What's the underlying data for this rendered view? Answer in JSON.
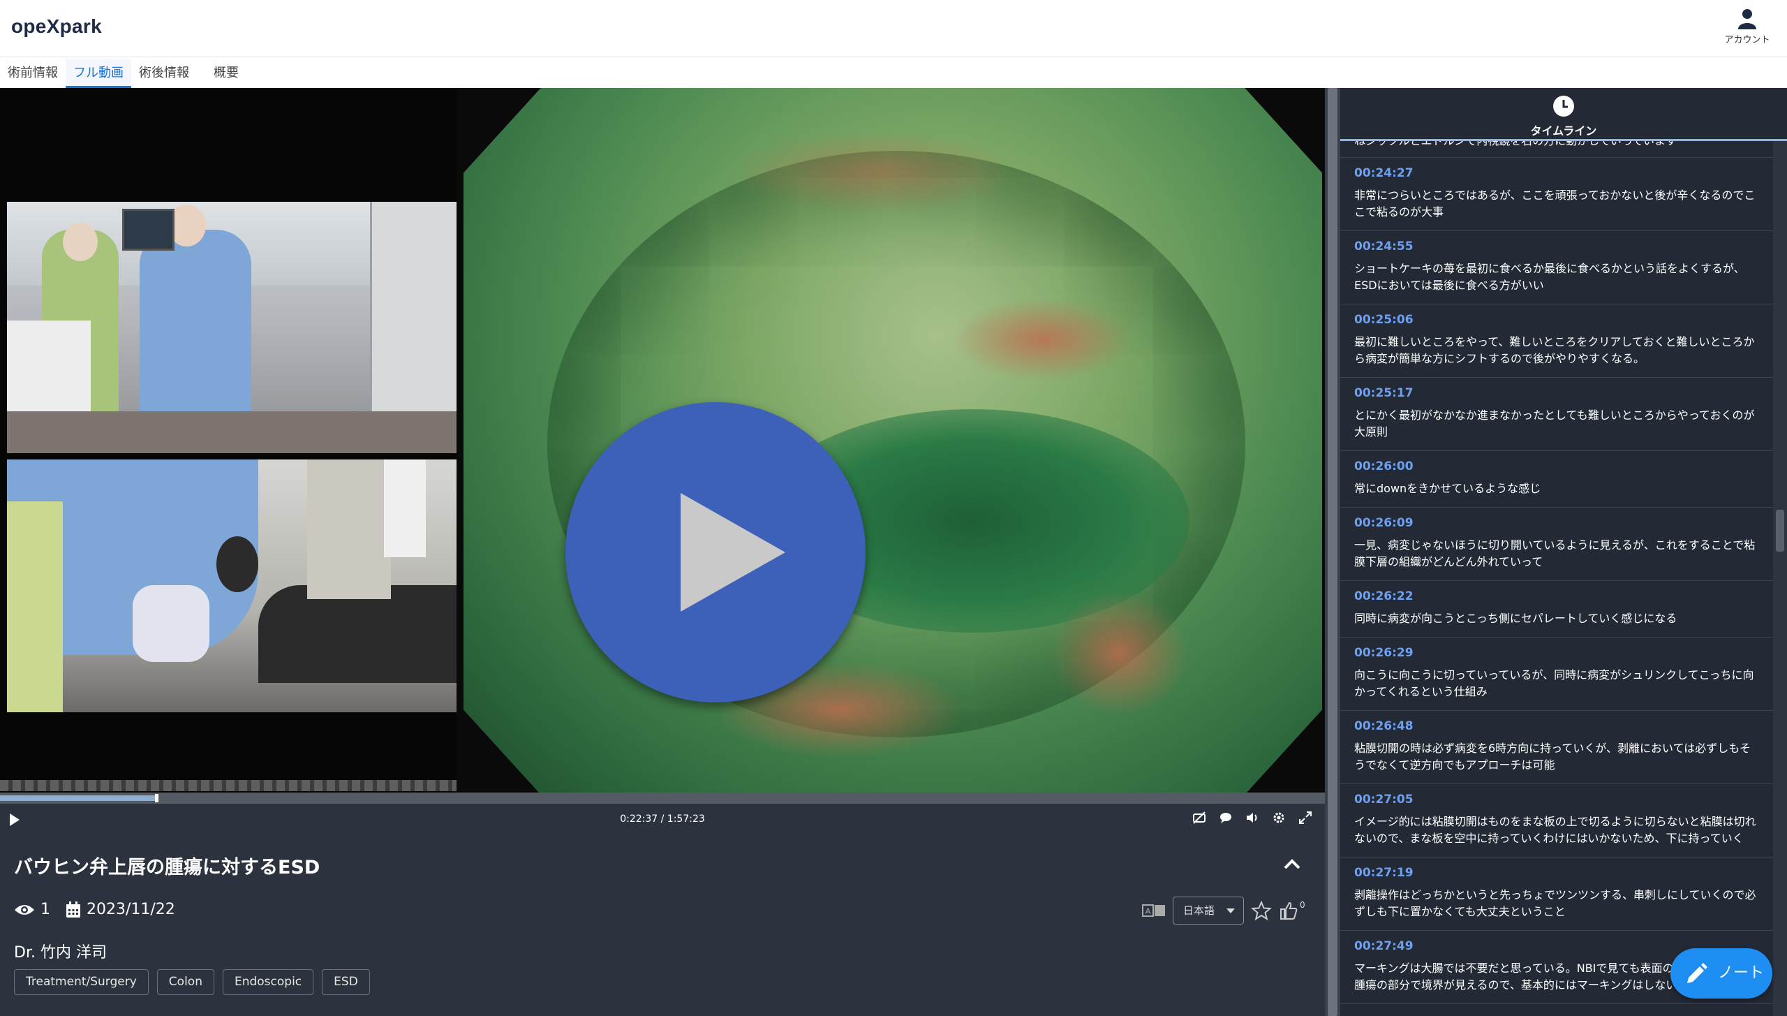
{
  "app": {
    "logo": "opeXpark",
    "account_label": "アカウント"
  },
  "tabs": [
    {
      "label": "術前情報",
      "active": false
    },
    {
      "label": "フル動画",
      "active": true
    },
    {
      "label": "術後情報",
      "active": false
    },
    {
      "label": "概要",
      "active": false
    }
  ],
  "player": {
    "timecode": "0:22:37 / 1:57:23",
    "progress": 0.117,
    "icons": [
      "captions-off-icon",
      "chat-bubble-icon",
      "volume-icon",
      "gear-icon",
      "fullscreen-icon"
    ]
  },
  "video": {
    "title": "バウヒン弁上唇の腫瘍に対するESD",
    "views": "1",
    "date": "2023/11/22",
    "doctor": "Dr. 竹内 洋司",
    "tags": [
      "Treatment/Surgery",
      "Colon",
      "Endoscopic",
      "ESD"
    ],
    "language": "日本語",
    "likes": "0"
  },
  "sidebar": {
    "title": "タイムライン",
    "partial_text": "ねジックルとエドルンで内視鏡を右の方に動かしていっています",
    "entries": [
      {
        "time": "00:24:27",
        "text": "非常につらいところではあるが、ここを頑張っておかないと後が辛くなるのでここで粘るのが大事"
      },
      {
        "time": "00:24:55",
        "text": "ショートケーキの苺を最初に食べるか最後に食べるかという話をよくするが、ESDにおいては最後に食べる方がいい"
      },
      {
        "time": "00:25:06",
        "text": "最初に難しいところをやって、難しいところをクリアしておくと難しいところから病変が簡単な方にシフトするので後がやりやすくなる。"
      },
      {
        "time": "00:25:17",
        "text": "とにかく最初がなかなか進まなかったとしても難しいところからやっておくのが大原則"
      },
      {
        "time": "00:26:00",
        "text": "常にdownをきかせているような感じ"
      },
      {
        "time": "00:26:09",
        "text": "一見、病変じゃないほうに切り開いているように見えるが、これをすることで粘膜下層の組織がどんどん外れていって"
      },
      {
        "time": "00:26:22",
        "text": "同時に病変が向こうとこっち側にセパレートしていく感じになる"
      },
      {
        "time": "00:26:29",
        "text": "向こうに向こうに切っていっているが、同時に病変がシュリンクしてこっちに向かってくれるという仕組み"
      },
      {
        "time": "00:26:48",
        "text": "粘膜切開の時は必ず病変を6時方向に持っていくが、剥離においては必ずしもそうでなくて逆方向でもアプローチは可能"
      },
      {
        "time": "00:27:05",
        "text": "イメージ的には粘膜切開はものをまな板の上で切るように切らないと粘膜は切れないので、まな板を空中に持っていくわけにはいかないため、下に持っていく"
      },
      {
        "time": "00:27:19",
        "text": "剥離操作はどっちかというと先っちょでツンツンする、串刺しにしていくので必ずしも下に置かなくても大丈夫ということ"
      },
      {
        "time": "00:27:49",
        "text": "マーキングは大腸では不要だと思っている。NBIで見ても表面の模様と腫瘍と非腫瘍の部分で境界が見えるので、基本的にはマーキングはしない"
      }
    ]
  },
  "note_button": {
    "label": "ノート"
  },
  "colors": {
    "accent": "#1a73d9",
    "timestamp": "#6ea0ef",
    "play": "#3d60b9",
    "note": "#1e8ef2"
  }
}
